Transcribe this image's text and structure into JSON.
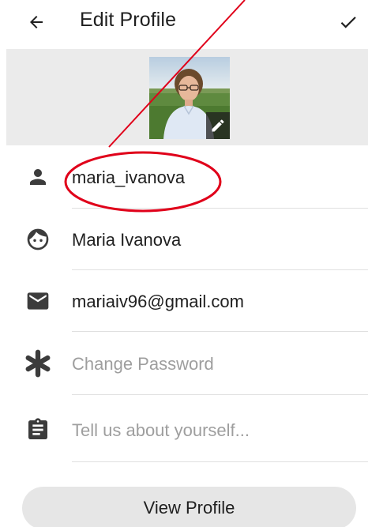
{
  "header": {
    "title": "Edit Profile",
    "back_icon": "arrow-left-icon",
    "save_icon": "check-icon"
  },
  "profile_photo": {
    "edit_icon": "pencil-icon"
  },
  "fields": [
    {
      "icon": "person-icon",
      "value": "maria_ivanova",
      "placeholder": false
    },
    {
      "icon": "face-icon",
      "value": "Maria Ivanova",
      "placeholder": false
    },
    {
      "icon": "email-icon",
      "value": "mariaiv96@gmail.com",
      "placeholder": false
    },
    {
      "icon": "asterisk-icon",
      "value": "Change Password",
      "placeholder": true
    },
    {
      "icon": "clipboard-icon",
      "value": "Tell us about yourself...",
      "placeholder": true
    }
  ],
  "view_profile_button": {
    "label": "View Profile"
  },
  "colors": {
    "annotation": "#e0001a",
    "band": "#ebebeb",
    "placeholder": "#9e9e9e"
  }
}
